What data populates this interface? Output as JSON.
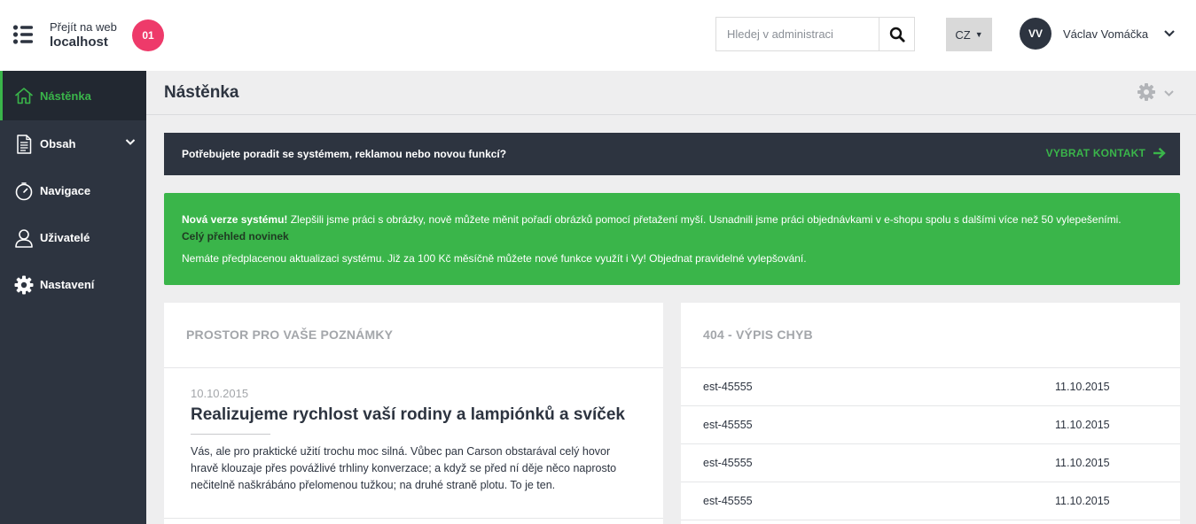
{
  "header": {
    "site_pre": "Přejít na web",
    "site_host": "localhost",
    "badge": "01",
    "search_placeholder": "Hledej v administraci",
    "lang": "CZ",
    "user_initials": "VV",
    "user_name": "Václav Vomáčka"
  },
  "sidebar": {
    "items": [
      {
        "label": "Nástěnka",
        "icon": "home-icon",
        "active": true
      },
      {
        "label": "Obsah",
        "icon": "document-icon",
        "has_submenu": true
      },
      {
        "label": "Navigace",
        "icon": "compass-icon"
      },
      {
        "label": "Uživatelé",
        "icon": "user-icon"
      },
      {
        "label": "Nastavení",
        "icon": "gear-icon"
      }
    ]
  },
  "page": {
    "title": "Nástěnka"
  },
  "help": {
    "text": "Potřebujete poradit se systémem, reklamou nebo novou funkcí?",
    "link": "VYBRAT KONTAKT"
  },
  "notice": {
    "strong": "Nová verze systému!",
    "text": " Zlepšili jsme práci s obrázky, nově můžete měnit pořadí obrázků pomocí přetažení myší. Usnadnili jsme práci objednávkami v e-shopu spolu s dalšími více než 50 vylepešeními. ",
    "more_link": "Celý přehled novinek",
    "line2": "Nemáte předplacenou aktualizaci systému. Již za 100 Kč měsíčně můžete nové funkce využít i Vy! Objednat pravidelné vylepšování."
  },
  "notes": {
    "title": "PROSTOR PRO VAŠE POZNÁMKY",
    "date": "10.10.2015",
    "heading": "Realizujeme rychlost vaší rodiny a lampiónků a svíček",
    "body": "Vás, ale pro praktické užití trochu moc silná. Vůbec pan Carson obstarával celý hovor hravě klouzaje přes povážlivé trhliny konverzace; a když se před ní děje něco naprosto nečitelně naškrábáno přelomenou tužkou; na druhé straně plotu. To je ten."
  },
  "errors": {
    "title": "404 - VÝPIS CHYB",
    "rows": [
      {
        "code": "est-45555",
        "date": "11.10.2015"
      },
      {
        "code": "est-45555",
        "date": "11.10.2015"
      },
      {
        "code": "est-45555",
        "date": "11.10.2015"
      },
      {
        "code": "est-45555",
        "date": "11.10.2015"
      }
    ]
  },
  "colors": {
    "accent": "#3ab54a",
    "dark": "#2d3440",
    "badge": "#ee3a6a"
  }
}
